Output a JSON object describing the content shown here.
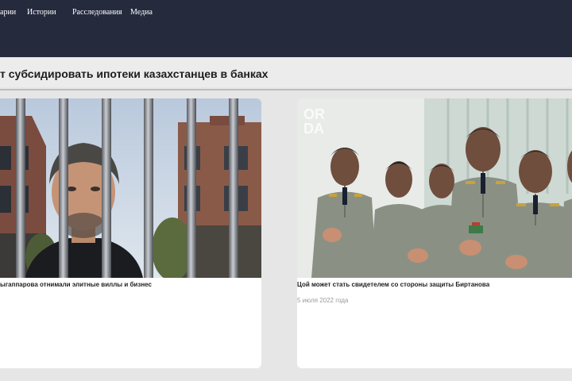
{
  "nav": {
    "items": [
      {
        "label": "арии"
      },
      {
        "label": "Истории"
      },
      {
        "label": "Расследования"
      },
      {
        "label": "Медиа"
      }
    ]
  },
  "headline": {
    "text": "т субсидировать ипотеки казахстанцев в банках"
  },
  "cards": [
    {
      "title": "ыгаппарова отнимали элитные виллы и бизнес",
      "image": "portrait-behind-bars-photo"
    },
    {
      "title": "Цой может стать свидетелем со стороны защиты Биртанова",
      "date": "5 июля 2022 года",
      "image": "military-officers-applauding-photo",
      "watermark": "ORDA"
    }
  ],
  "colors": {
    "nav_bg": "#252a3d",
    "page_bg": "#e6e6e6",
    "card_bg": "#ffffff",
    "date_text": "#9a9a9a"
  }
}
